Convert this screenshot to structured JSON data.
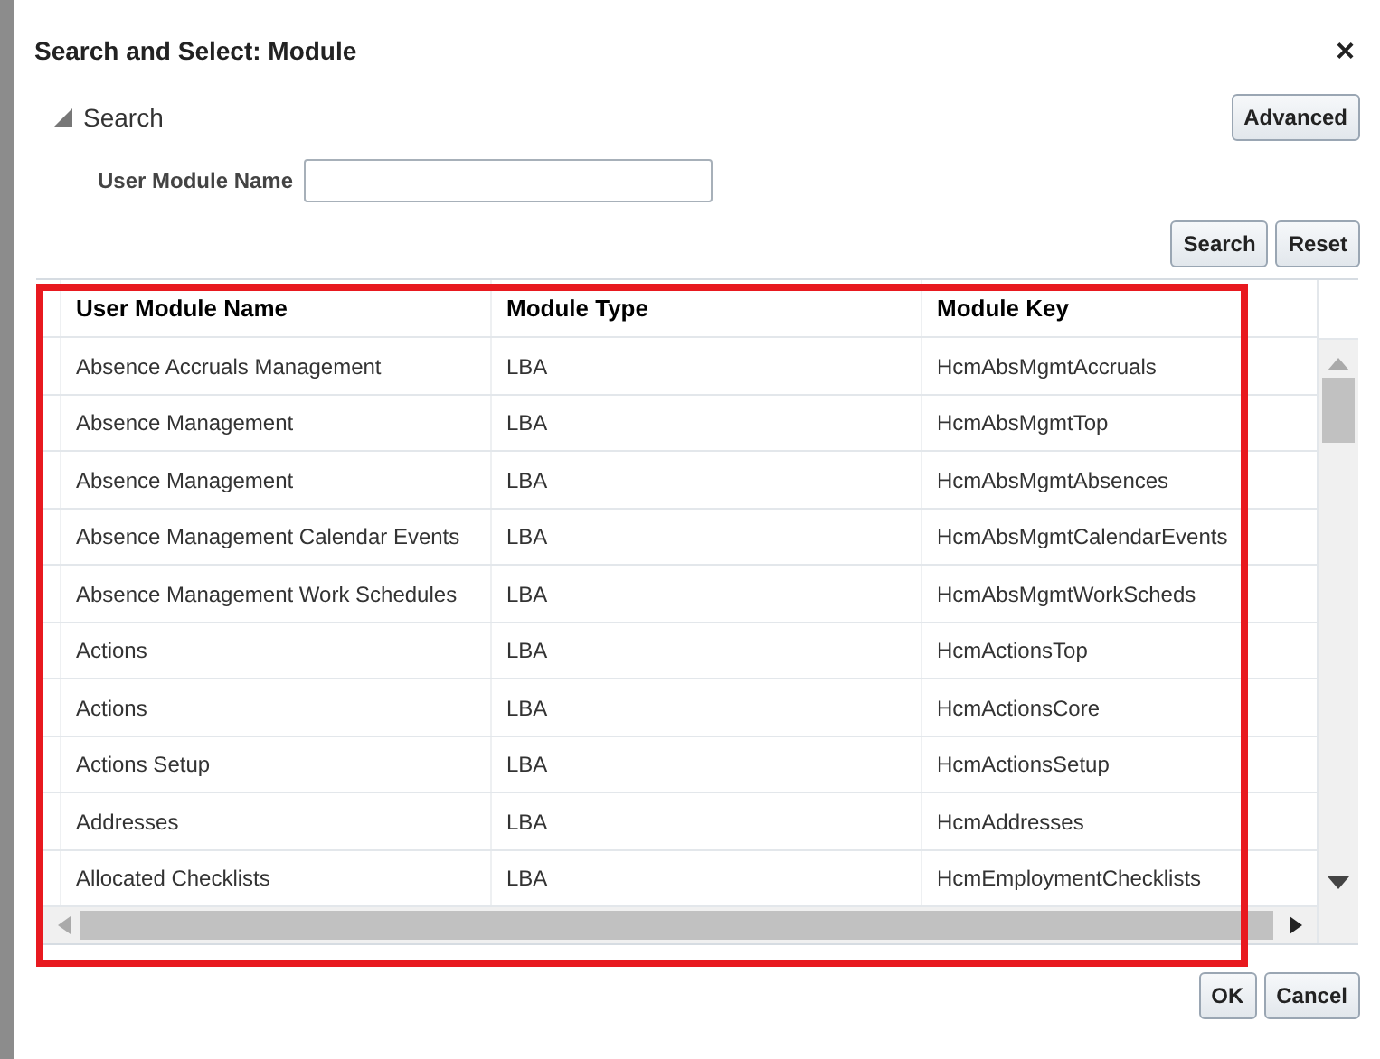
{
  "dialog": {
    "title": "Search and Select: Module",
    "close": "×"
  },
  "search": {
    "label": "Search",
    "expanded": true,
    "advanced": "Advanced",
    "field_label": "User Module Name",
    "buttons": [
      "Search",
      "Reset"
    ]
  },
  "table": {
    "columns": [
      "User Module Name",
      "Module Type",
      "Module Key"
    ],
    "rows": [
      [
        "Absence Accruals Management",
        "LBA",
        "HcmAbsMgmtAccruals"
      ],
      [
        "Absence Management",
        "LBA",
        "HcmAbsMgmtTop"
      ],
      [
        "Absence Management",
        "LBA",
        "HcmAbsMgmtAbsences"
      ],
      [
        "Absence Management Calendar Events",
        "LBA",
        "HcmAbsMgmtCalendarEvents"
      ],
      [
        "Absence Management Work Schedules",
        "LBA",
        "HcmAbsMgmtWorkScheds"
      ],
      [
        "Actions",
        "LBA",
        "HcmActionsTop"
      ],
      [
        "Actions",
        "LBA",
        "HcmActionsCore"
      ],
      [
        "Actions Setup",
        "LBA",
        "HcmActionsSetup"
      ],
      [
        "Addresses",
        "LBA",
        "HcmAddresses"
      ],
      [
        "Allocated Checklists",
        "LBA",
        "HcmEmploymentChecklists"
      ]
    ]
  },
  "footer": {
    "buttons": [
      "OK",
      "Cancel"
    ]
  }
}
